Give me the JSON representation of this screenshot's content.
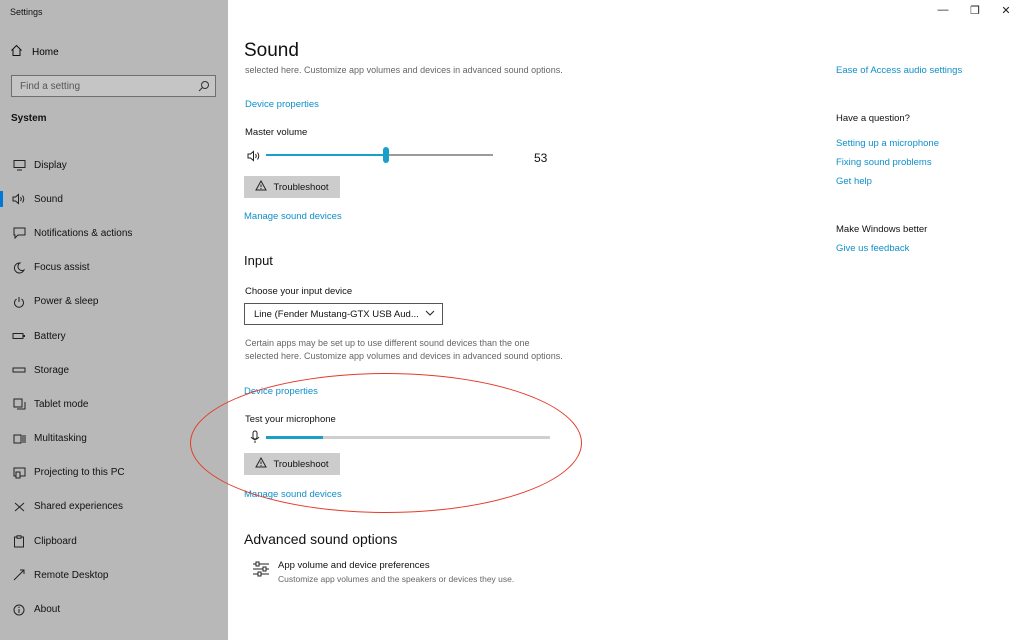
{
  "window": {
    "title": "Settings",
    "controls": {
      "minimize": "—",
      "restore": "❐",
      "close": "✕"
    }
  },
  "sidebar": {
    "home_label": "Home",
    "search_placeholder": "Find a setting",
    "section": "System",
    "items": [
      {
        "label": "Display",
        "icon": "display-icon"
      },
      {
        "label": "Sound",
        "icon": "speaker-icon",
        "active": true
      },
      {
        "label": "Notifications & actions",
        "icon": "notifications-icon"
      },
      {
        "label": "Focus assist",
        "icon": "moon-icon"
      },
      {
        "label": "Power & sleep",
        "icon": "power-icon"
      },
      {
        "label": "Battery",
        "icon": "battery-icon"
      },
      {
        "label": "Storage",
        "icon": "storage-icon"
      },
      {
        "label": "Tablet mode",
        "icon": "tablet-icon"
      },
      {
        "label": "Multitasking",
        "icon": "multitasking-icon"
      },
      {
        "label": "Projecting to this PC",
        "icon": "projecting-icon"
      },
      {
        "label": "Shared experiences",
        "icon": "shared-icon"
      },
      {
        "label": "Clipboard",
        "icon": "clipboard-icon"
      },
      {
        "label": "Remote Desktop",
        "icon": "remote-desktop-icon"
      },
      {
        "label": "About",
        "icon": "info-icon"
      }
    ]
  },
  "main": {
    "title": "Sound",
    "output": {
      "desc_partial": "selected here. Customize app volumes and devices in advanced sound options.",
      "device_properties": "Device properties",
      "master_volume_label": "Master volume",
      "volume_value": "53",
      "volume_fraction": 0.53,
      "troubleshoot": "Troubleshoot",
      "manage": "Manage sound devices"
    },
    "input": {
      "heading": "Input",
      "choose_label": "Choose your input device",
      "selected_device": "Line (Fender Mustang-GTX USB Aud...",
      "desc": "Certain apps may be set up to use different sound devices than the one selected here. Customize app volumes and devices in advanced sound options.",
      "device_properties": "Device properties",
      "test_label": "Test your microphone",
      "mic_level": 0.2,
      "troubleshoot": "Troubleshoot",
      "manage": "Manage sound devices"
    },
    "advanced": {
      "heading": "Advanced sound options",
      "item_title": "App volume and device preferences",
      "item_sub": "Customize app volumes and the speakers or devices they use."
    }
  },
  "right": {
    "ease_link": "Ease of Access audio settings",
    "question_heading": "Have a question?",
    "links": [
      "Setting up a microphone",
      "Fixing sound problems",
      "Get help"
    ],
    "better_heading": "Make Windows better",
    "feedback_link": "Give us feedback"
  },
  "colors": {
    "accent": "#1aa0c8",
    "link": "#0f8fc9",
    "annotation": "#e43c2a"
  }
}
